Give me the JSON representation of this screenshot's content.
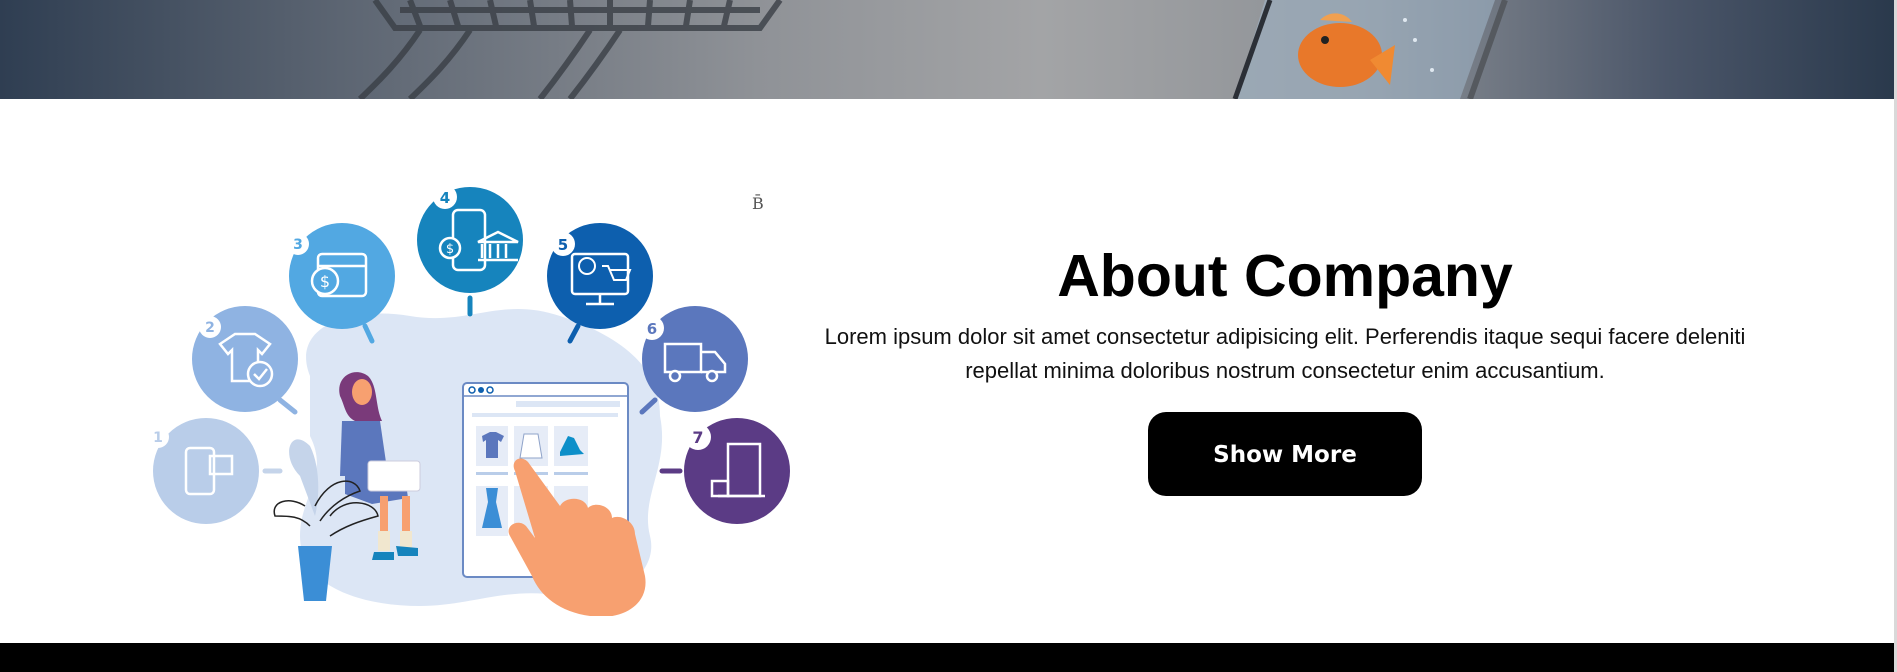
{
  "about": {
    "title": "About Company",
    "description": "Lorem ipsum dolor sit amet consectetur adipisicing elit. Perferendis itaque sequi facere deleniti repellat minima doloribus nostrum consectetur enim accusantium.",
    "button_label": "Show More"
  },
  "illustration": {
    "steps": [
      {
        "number": "1",
        "icon": "mobile-shopping-icon",
        "color": "#b9cde9"
      },
      {
        "number": "2",
        "icon": "tshirt-check-icon",
        "color": "#8fb3e2"
      },
      {
        "number": "3",
        "icon": "payment-card-icon",
        "color": "#52a8e2"
      },
      {
        "number": "4",
        "icon": "mobile-bank-transfer-icon",
        "color": "#1684bd"
      },
      {
        "number": "5",
        "icon": "online-cart-icon",
        "color": "#0d5fae"
      },
      {
        "number": "6",
        "icon": "delivery-truck-icon",
        "color": "#5b77bd"
      },
      {
        "number": "7",
        "icon": "door-delivery-icon",
        "color": "#5b3b85"
      }
    ]
  },
  "marker": "B̄",
  "colors": {
    "button_bg": "#000000",
    "footer": "#000000"
  }
}
